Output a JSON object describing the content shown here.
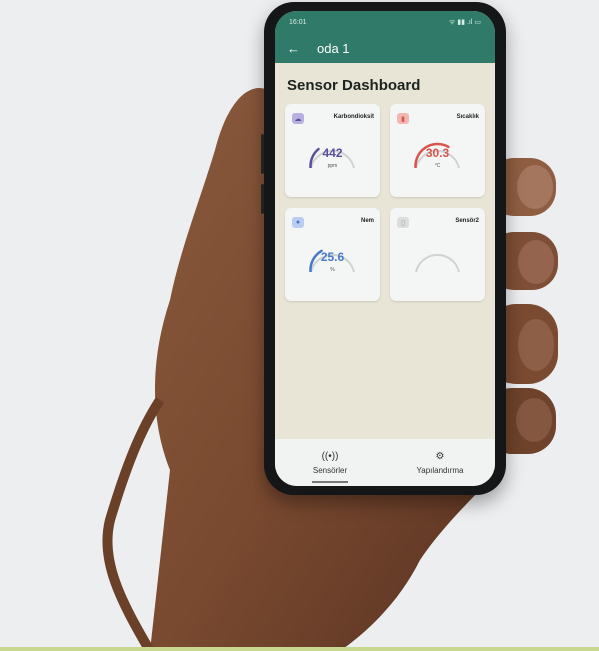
{
  "status_bar": {
    "time": "16:01",
    "indicators": "ᯤ ▮▮ .ıl ▭"
  },
  "app_bar": {
    "back_icon": "arrow-left",
    "title": "oda 1"
  },
  "dashboard": {
    "title": "Sensor Dashboard",
    "cards": [
      {
        "name": "Karbondioksit",
        "value": "442",
        "unit": "ppm",
        "color": "#5a4f9c",
        "icon_color": "#b8b0e0",
        "icon": "cloud-icon",
        "level": 0.3
      },
      {
        "name": "Sıcaklık",
        "value": "30.3",
        "unit": "°C",
        "color": "#d9544c",
        "icon_color": "#f3b7b2",
        "icon": "thermometer-icon",
        "level": 0.65
      },
      {
        "name": "Nem",
        "value": "25.6",
        "unit": "%",
        "color": "#4a78c8",
        "icon_color": "#b8cdf0",
        "icon": "water-drop-icon",
        "level": 0.35
      },
      {
        "name": "Sensör2",
        "value": "",
        "unit": "",
        "color": "#999999",
        "icon_color": "#dddddd",
        "icon": "sensor-icon",
        "level": 0
      }
    ]
  },
  "bottom_nav": {
    "items": [
      {
        "label": "Sensörler",
        "icon": "((•))"
      },
      {
        "label": "Yapılandırma",
        "icon": "⚙"
      }
    ]
  }
}
